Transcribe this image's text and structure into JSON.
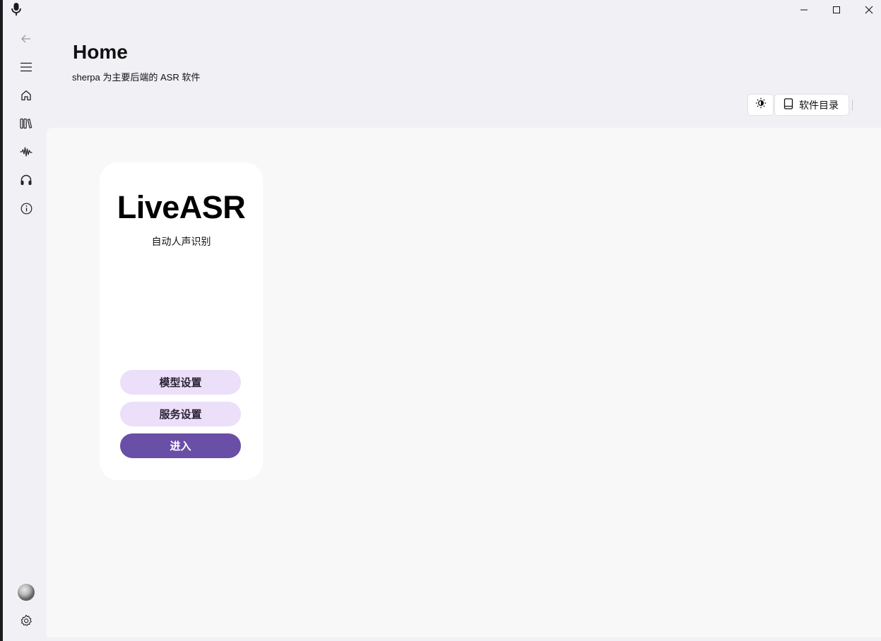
{
  "header": {
    "title": "Home",
    "subtitle": "sherpa 为主要后端的 ASR 软件",
    "dir_button_label": "软件目录"
  },
  "nav": {
    "items": [
      "back-icon",
      "menu-icon",
      "home-icon",
      "library-icon",
      "waveform-icon",
      "headphones-icon",
      "info-icon"
    ],
    "footer": [
      "avatar",
      "settings-icon"
    ]
  },
  "card": {
    "title": "LiveASR",
    "subtitle": "自动人声识别",
    "model_settings_label": "模型设置",
    "service_settings_label": "服务设置",
    "enter_label": "进入"
  },
  "colors": {
    "accent": "#6a4fa6",
    "accent_light": "#ebdffa",
    "background": "#f1f0f5",
    "content_bg": "#f8f8f9"
  }
}
